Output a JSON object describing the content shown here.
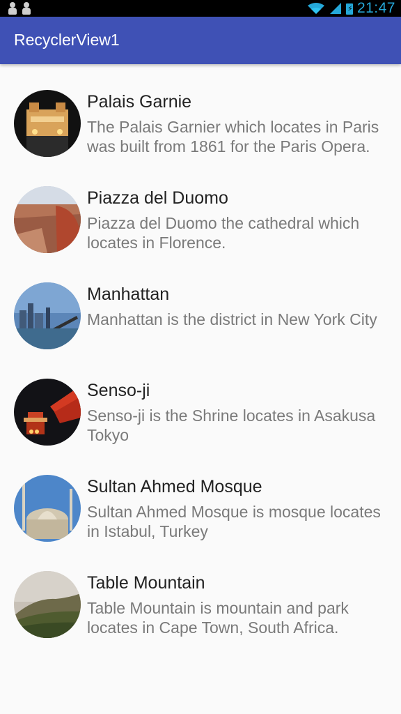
{
  "status_bar": {
    "time": "21:47",
    "icons": [
      "person-icon",
      "person-icon",
      "wifi-icon",
      "signal-icon",
      "battery-icon"
    ]
  },
  "app_bar": {
    "title": "RecyclerView1",
    "color": "#3f51b5"
  },
  "items": [
    {
      "title": "Palais Garnie",
      "description": "The Palais Garnier which locates in Paris was built from 1861 for the Paris Opera.",
      "image": "palais-garnier-image"
    },
    {
      "title": "Piazza del Duomo",
      "description": "Piazza del Duomo the cathedral which locates in Florence.",
      "image": "piazza-del-duomo-image"
    },
    {
      "title": "Manhattan",
      "description": "Manhattan is the district in New York City",
      "image": "manhattan-image"
    },
    {
      "title": "Senso-ji",
      "description": "Senso-ji is the Shrine locates in Asakusa Tokyo",
      "image": "senso-ji-image"
    },
    {
      "title": "Sultan Ahmed Mosque",
      "description": "Sultan Ahmed Mosque is mosque locates in Istabul, Turkey",
      "image": "sultan-ahmed-mosque-image"
    },
    {
      "title": "Table Mountain",
      "description": "Table Mountain is mountain and park locates in Cape Town, South Africa.",
      "image": "table-mountain-image"
    }
  ]
}
